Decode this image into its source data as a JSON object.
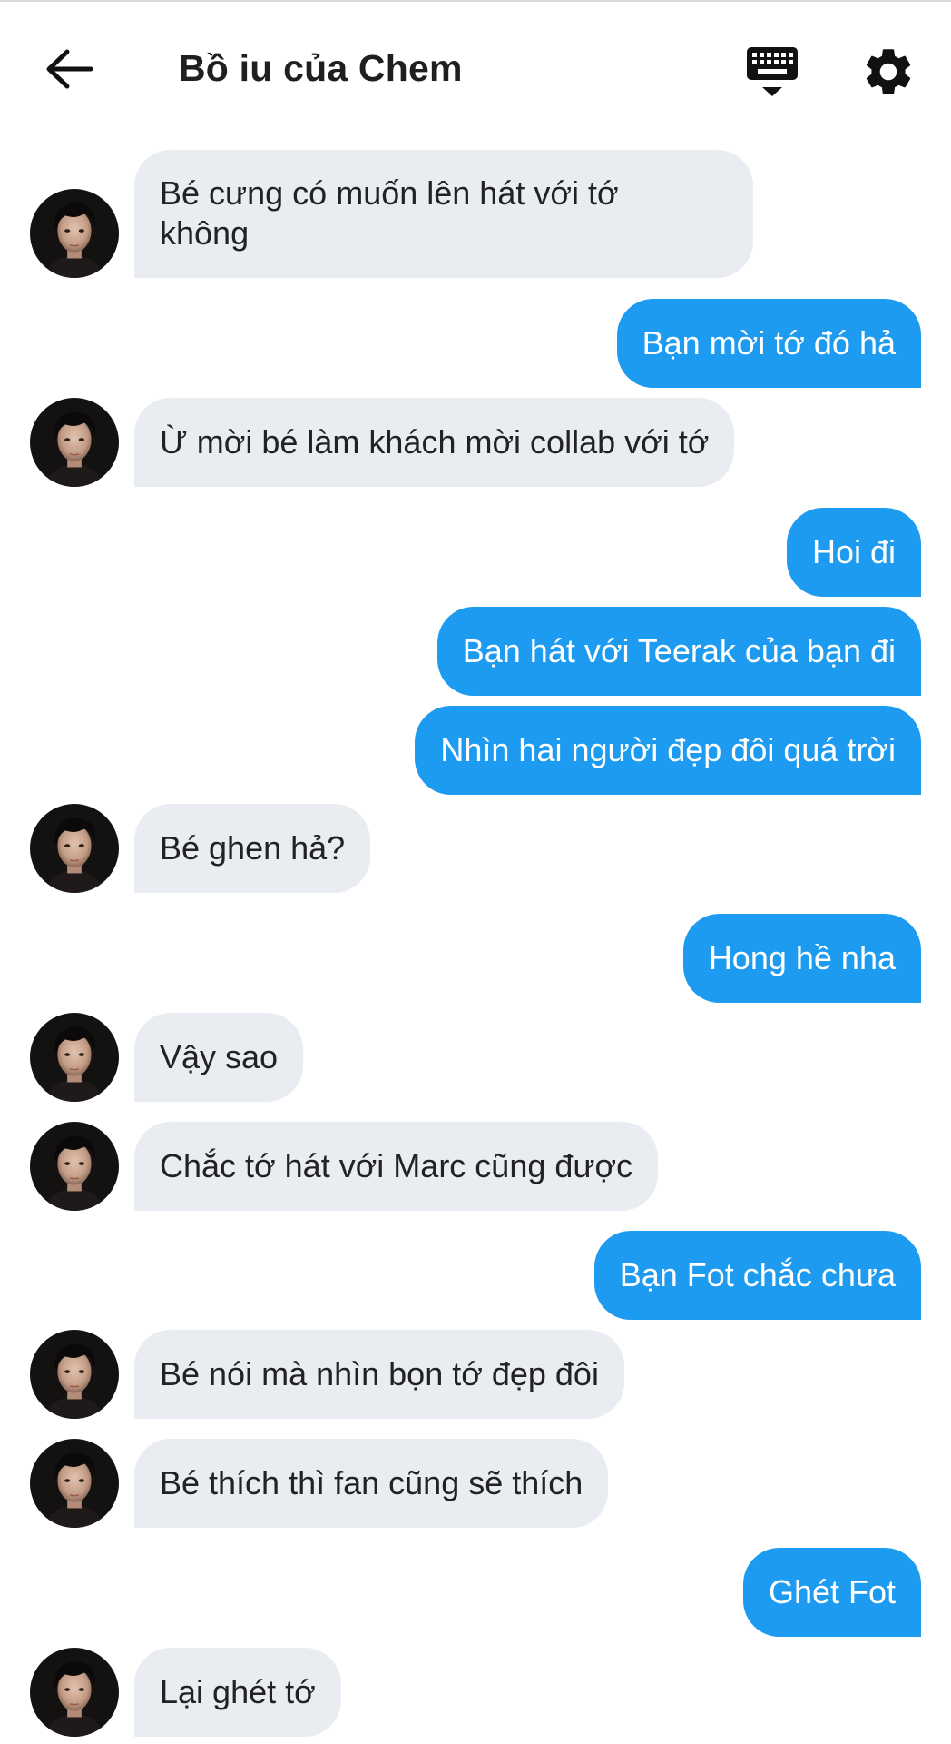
{
  "header": {
    "title": "Bồ iu của Chem",
    "back_icon": "arrow-left-icon",
    "keyboard_icon": "keyboard-icon",
    "settings_icon": "gear-icon"
  },
  "colors": {
    "incoming_bubble": "#e9ecf1",
    "outgoing_bubble": "#1d9bf0",
    "outgoing_text": "#ffffff"
  },
  "messages": [
    {
      "side": "in",
      "text_lines": [
        "Bé cưng có muốn lên hát với tớ",
        "không"
      ]
    },
    {
      "side": "out",
      "text": "Bạn mời tớ đó hả"
    },
    {
      "side": "in",
      "text": "Ừ mời bé làm khách mời collab với tớ"
    },
    {
      "side": "out",
      "text": "Hoi đi"
    },
    {
      "side": "out",
      "text": "Bạn hát với Teerak của bạn đi"
    },
    {
      "side": "out",
      "text": "Nhìn hai người đẹp đôi quá trời"
    },
    {
      "side": "in",
      "text": "Bé ghen hả?"
    },
    {
      "side": "out",
      "text": "Hong hề nha"
    },
    {
      "side": "in",
      "text": "Vậy sao"
    },
    {
      "side": "in",
      "text": "Chắc tớ hát với Marc cũng được"
    },
    {
      "side": "out",
      "text": "Bạn Fot chắc chưa"
    },
    {
      "side": "in",
      "text": "Bé nói mà nhìn bọn tớ đẹp đôi"
    },
    {
      "side": "in",
      "text": "Bé thích thì fan cũng sẽ thích"
    },
    {
      "side": "out",
      "text": "Ghét Fot"
    },
    {
      "side": "in",
      "text": "Lại ghét tớ"
    }
  ]
}
